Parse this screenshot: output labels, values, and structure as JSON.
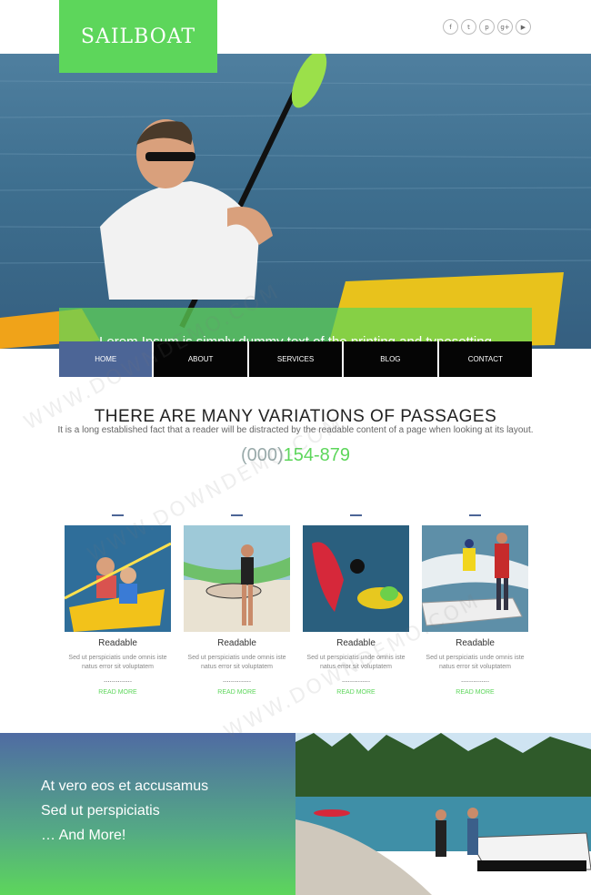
{
  "logo": "SAILBOAT",
  "social": [
    {
      "glyph": "f",
      "icon": "facebook-icon"
    },
    {
      "glyph": "t",
      "icon": "twitter-icon"
    },
    {
      "glyph": "p",
      "icon": "pinterest-icon"
    },
    {
      "glyph": "g+",
      "icon": "googleplus-icon"
    },
    {
      "glyph": "▶",
      "icon": "youtube-icon"
    }
  ],
  "hero": {
    "caption": "Lorem Ipsum is simply dummy text of the printing and typesetting industry. Lorem Ipsum has been the industry's standard"
  },
  "nav": [
    "HOME",
    "ABOUT",
    "SERVICES",
    "BLOG",
    "CONTACT"
  ],
  "intro": {
    "title": "THERE ARE MANY VARIATIONS OF PASSAGES",
    "text": "It is a long established fact that a reader will be distracted by the readable content of a page when looking at its layout.",
    "phone_prefix": "(000)",
    "phone_number": "154-879"
  },
  "cards": [
    {
      "title": "Readable",
      "desc": "Sed ut perspiciatis unde omnis iste natus error sit voluptatem",
      "dots": "..............",
      "more": "READ MORE"
    },
    {
      "title": "Readable",
      "desc": "Sed ut perspiciatis unde omnis iste natus error sit voluptatem",
      "dots": "..............",
      "more": "READ MORE"
    },
    {
      "title": "Readable",
      "desc": "Sed ut perspiciatis unde omnis iste natus error sit voluptatem",
      "dots": "..............",
      "more": "READ MORE"
    },
    {
      "title": "Readable",
      "desc": "Sed ut perspiciatis unde omnis iste natus error sit voluptatem",
      "dots": "..............",
      "more": "READ MORE"
    }
  ],
  "footer_promo": [
    "At vero eos et accusamus",
    "Sed ut perspiciatis",
    "… And More!"
  ],
  "watermark": "WWW.DOWNDEMO.COM",
  "colors": {
    "accent": "#5dd65b",
    "nav_active": "#4c6596",
    "nav_bg": "#050505"
  }
}
